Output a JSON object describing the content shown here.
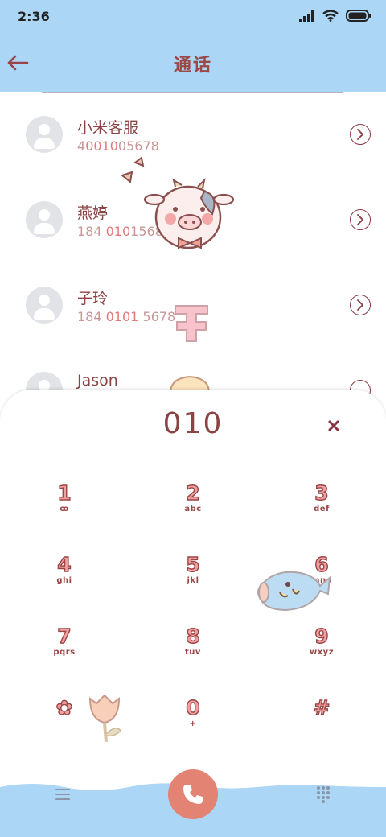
{
  "status_bar": {
    "time": "2:36"
  },
  "header": {
    "title": "通话"
  },
  "contacts": [
    {
      "name": "小米客服",
      "number_parts": [
        "4",
        "0010",
        "05678"
      ]
    },
    {
      "name": "燕婷",
      "number_parts": [
        "184 ",
        "010",
        "15689"
      ]
    },
    {
      "name": "子玲",
      "number_parts": [
        "184 ",
        "0101",
        " 5678"
      ]
    },
    {
      "name": "Jason"
    }
  ],
  "dialpad": {
    "display": "010",
    "keys": [
      {
        "digit": "1",
        "letters": "ꝏ"
      },
      {
        "digit": "2",
        "letters": "abc"
      },
      {
        "digit": "3",
        "letters": "def"
      },
      {
        "digit": "4",
        "letters": "ghi"
      },
      {
        "digit": "5",
        "letters": "jkl"
      },
      {
        "digit": "6",
        "letters": "mno"
      },
      {
        "digit": "7",
        "letters": "pqrs"
      },
      {
        "digit": "8",
        "letters": "tuv"
      },
      {
        "digit": "9",
        "letters": "wxyz"
      },
      {
        "digit": "✿",
        "letters": ""
      },
      {
        "digit": "0",
        "letters": "+"
      },
      {
        "digit": "#",
        "letters": ""
      }
    ]
  },
  "icons": {
    "back": "arrow-left-icon",
    "clear": "close-icon",
    "call": "phone-icon",
    "menu": "menu-icon",
    "keypad": "keypad-icon"
  },
  "colors": {
    "header_bg": "#abd6f5",
    "accent_text": "#8a4444",
    "call_button": "#e38373"
  }
}
